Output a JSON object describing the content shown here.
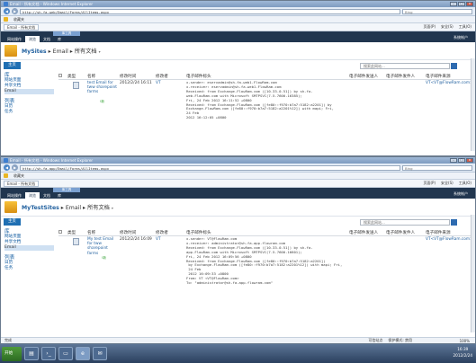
{
  "window1": {
    "title": "Email - 所有文档 - Windows Internet Explorer",
    "url": "http://sh-fa-web/Email/Forms/AllItems.aspx",
    "search_placeholder": "Bing",
    "favorites_label": "收藏夹",
    "tab_title": "Email - 所有文档",
    "commands": [
      "页面(P)",
      "安全(S)",
      "工具(O)"
    ],
    "ribbon_group": "库工具",
    "ribbon_tabs": [
      "网站操作",
      "浏览",
      "文档",
      "库"
    ],
    "user": "系统帐户",
    "site": "MySites",
    "library": "Email",
    "view": "所有文档",
    "home_label": "主页",
    "site_search_placeholder": "搜索此网站...",
    "quick_launch": [
      "库",
      "网站页面",
      "共享文档",
      "Email",
      "列表",
      "日历",
      "任务"
    ],
    "columns": [
      "类型",
      "名称",
      "修改时间",
      "修改者",
      "电子邮件标头",
      "电子邮件发送人",
      "电子邮件发件人",
      "电子邮件来源"
    ],
    "row": {
      "name": "test Email for tww sharepoint farms",
      "new_tag": "!新",
      "modified": "2012/2/24 16:11",
      "modified_by": "VT",
      "headers": "x-sender: eservadmin@sh-fa-web1.FlowRam.com\nx-receiver: eservadmin@sh-fa-web1.FlowRam.com\nReceived: from Exchange.FlowRam.com ([10.33.0.51]) by sh-fa-\nweb.FlowRam.com with Microsoft SMTPSVC(7.5.7600.16385);\nFri, 24 Feb 2012 16:11:52 +0800\nReceived: from Exchange.FlowRam.com ([fe80::f970:b7a7:5182:a2201]) by\nExchange.FlowRam.com ([fe80::f970:b7a7:5182:a2201%12]) with mapi; Fri,\n24 Feb\n2012 16:12:05 +0800",
      "sender_from": "VT<VT@FlowRam.com>"
    },
    "zoom": "100%"
  },
  "window2": {
    "title": "Email - 所有文档 - Windows Internet Explorer",
    "url": "http://sh-fa-app/Email/Forms/AllItems.aspx",
    "search_placeholder": "Bing",
    "favorites_label": "收藏夹",
    "tab_title": "Email - 所有文档",
    "commands": [
      "页面(P)",
      "安全(S)",
      "工具(O)"
    ],
    "ribbon_group": "库工具",
    "ribbon_tabs": [
      "网站操作",
      "浏览",
      "文档",
      "库"
    ],
    "user": "系统帐户",
    "site": "MyTestSites",
    "library": "Email",
    "view": "所有文档",
    "home_label": "主页",
    "site_search_placeholder": "搜索此网站...",
    "quick_launch": [
      "库",
      "网站页面",
      "共享文档",
      "Email",
      "列表",
      "日历",
      "任务"
    ],
    "columns": [
      "类型",
      "名称",
      "修改时间",
      "修改者",
      "电子邮件标头",
      "电子邮件发送人",
      "电子邮件发件人",
      "电子邮件来源"
    ],
    "row": {
      "name": "My test Email for tww sharepoint farms",
      "new_tag": "!新",
      "modified": "2012/2/24 16:09",
      "modified_by": "VT",
      "headers": "x-sender: VT@FlowRam.com\nx-receiver: administrator@sh-fa-app.flowram.com\nReceived: from Exchange.FlowRam.com ([10.33.0.51]) by sh-fa-\napp.FlowRam.com with Microsoft SMTPSVC(7.5.7600.16601);\nFri, 24 Feb 2012 16:09:56 +0800\nReceived: from Exchange.FlowRam.com ([fe80::f970:b7a7:5182:a2201])\n by Exchange.FlowRam.com ([fe80::f970:b7a7:5182:a2201%12]) with mapi; Fri,\n 24 Feb\n 2012 16:09:33 +0800\nFrom: VT <VT@FlowRam.com>\nTo: \"administrator@sh-fa-app.flowram.com\"",
      "sender_from": "VT<VT@FlowRam.com>"
    },
    "zoom": "100%"
  },
  "status": {
    "done": "完成",
    "zone": "可信站点",
    "protected": "保护模式: 禁用"
  },
  "taskbar": {
    "start": "开始",
    "time": "16:39",
    "date": "2012/2/24"
  }
}
